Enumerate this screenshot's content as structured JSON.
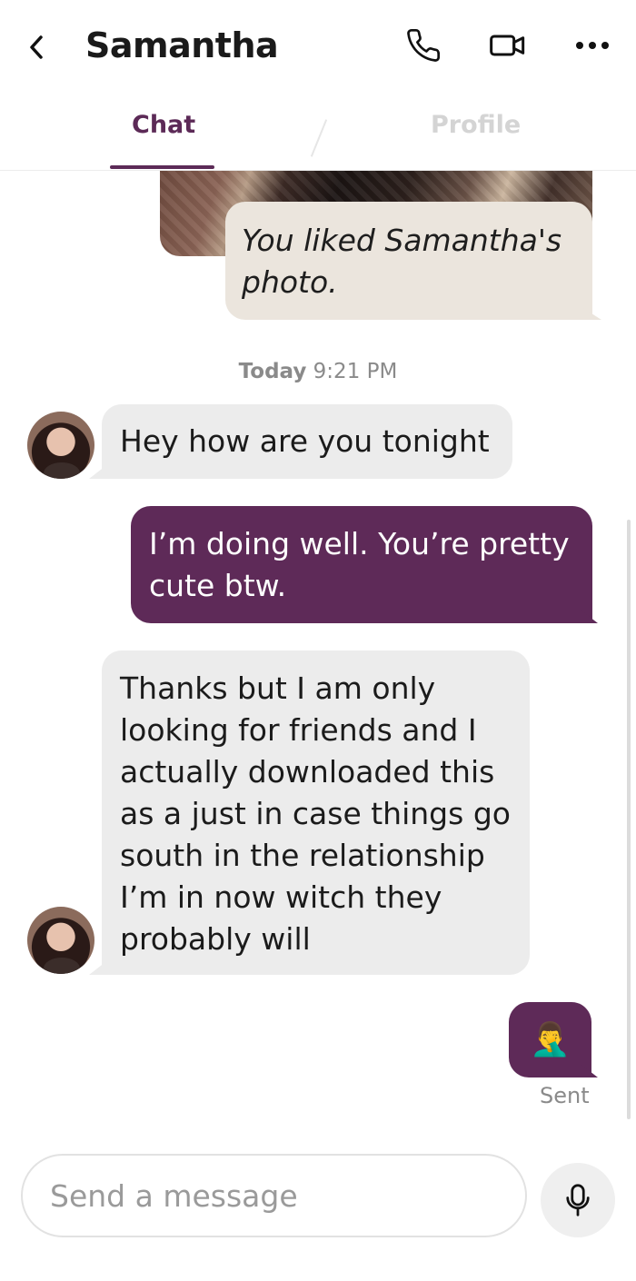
{
  "header": {
    "title": "Samantha",
    "back_icon": "chevron-left-icon",
    "call_icon": "phone-icon",
    "video_icon": "video-camera-icon",
    "more_icon": "more-horizontal-icon"
  },
  "tabs": [
    {
      "label": "Chat",
      "active": true
    },
    {
      "label": "Profile",
      "active": false
    }
  ],
  "messages": {
    "liked_photo": "You liked Samantha's photo.",
    "timestamp_day": "Today",
    "timestamp_time": "9:21 PM",
    "m1": "Hey how are you tonight",
    "m2_line1": "I’m doing well. You’re pretty",
    "m2_line2": "cute btw.",
    "m3_lines": [
      "Thanks but I am only",
      "looking for friends and I",
      "actually downloaded this",
      "as a just in case things go",
      "south in the relationship",
      "I’m in now witch they",
      "probably will"
    ],
    "m4_emoji": "🤦‍♂️",
    "status": "Sent"
  },
  "composer": {
    "placeholder": "Send a message",
    "mic_icon": "microphone-icon"
  },
  "colors": {
    "accent": "#5e2a58",
    "incoming_bubble": "#ececec",
    "liked_bubble": "#ebe5dd"
  }
}
